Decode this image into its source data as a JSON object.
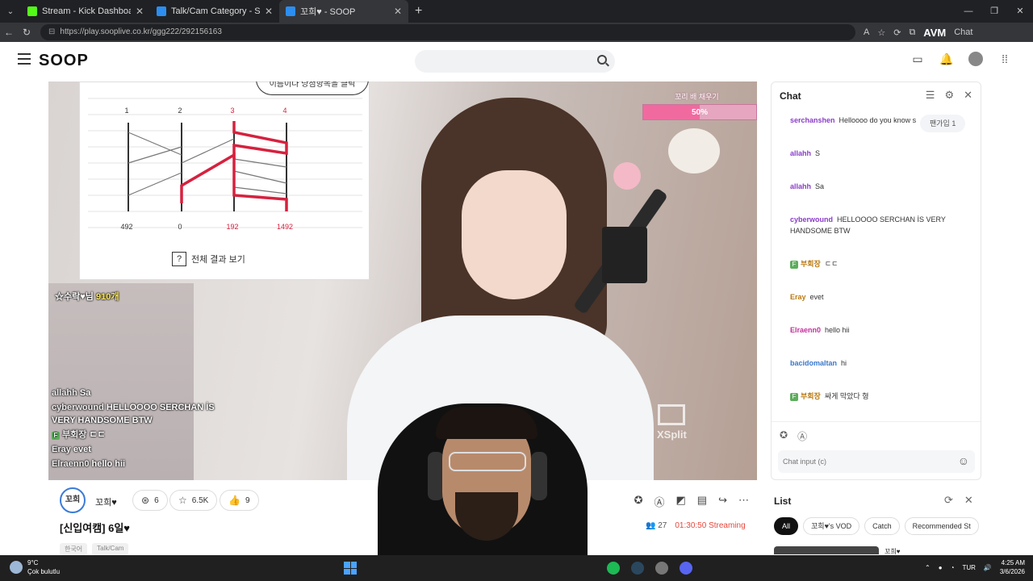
{
  "browser": {
    "tabs": [
      {
        "title": "Stream - Kick Dashboard",
        "favicon_color": "#53fc18"
      },
      {
        "title": "Talk/Cam Category - SOOP",
        "favicon_color": "#2b8ef0"
      },
      {
        "title": "꼬희♥ - SOOP",
        "favicon_color": "#2b8ef0",
        "active": true
      }
    ],
    "url": "https://play.sooplive.co.kr/ggg222/292156163",
    "extension_label": "AVM",
    "chat_link": "Chat"
  },
  "site": {
    "logo": "SOOP",
    "search_placeholder": ""
  },
  "video": {
    "overlay": {
      "top_caption": "이름이나 당첨항목을 클릭",
      "columns": [
        "1",
        "2",
        "3",
        "4"
      ],
      "values": [
        "492",
        "0",
        "192",
        "1492"
      ],
      "caption": "전체 결과 보기"
    },
    "count_label": "☆수락♥님",
    "count_value": "910개",
    "donation_label": "꼬리 배 채우기",
    "donation_percent_label": "50%",
    "donation_fraction": 0.5,
    "watermark": "XSplit",
    "chat": [
      {
        "user": "allahh",
        "text": "Sa"
      },
      {
        "user": "cyberwound",
        "text": "HELLOOOO SERCHAN İS VERY HANDSOME BTW"
      },
      {
        "user": "부회장",
        "text": "ㄷㄷ",
        "badge": "F"
      },
      {
        "user": "Eray",
        "text": "evet"
      },
      {
        "user": "Elraenn0",
        "text": "hello hii"
      }
    ]
  },
  "streamer": {
    "avatar_text": "꼬희",
    "name": "꼬희♥",
    "stats": {
      "badge": "6",
      "favorites": "6.5K",
      "likes": "9"
    },
    "title": "[신입여캠] 6일♥",
    "viewers": "27",
    "duration": "01:30:50 Streaming",
    "tags": [
      "한국어",
      "Talk/Cam"
    ]
  },
  "chat": {
    "title": "Chat",
    "fan_tag": "팬가입 1",
    "messages": [
      {
        "user": "serchanshen",
        "text": "Helloooo do you know s",
        "color": "#8a3cc9"
      },
      {
        "user": "allahh",
        "text": "S",
        "color": "#8a3cc9"
      },
      {
        "user": "allahh",
        "text": "Sa",
        "color": "#8a3cc9"
      },
      {
        "user": "cyberwound",
        "text": "HELLOOOO SERCHAN İS VERY HANDSOME BTW",
        "color": "#8a3cc9"
      },
      {
        "user": "부회장",
        "text": "ㄷㄷ",
        "color": "#b9790f",
        "badge": "F"
      },
      {
        "user": "Eray",
        "text": "evet",
        "color": "#b9790f"
      },
      {
        "user": "Elraenn0",
        "text": "hello hii",
        "color": "#c22f9a"
      },
      {
        "user": "bacidomaltan",
        "text": "hi",
        "color": "#3a78c9"
      },
      {
        "user": "부회장",
        "text": "싸게 막았다 형",
        "color": "#b9790f",
        "badge": "F"
      }
    ],
    "input_placeholder": "Chat input (c)"
  },
  "list": {
    "title": "List",
    "tabs": [
      "All",
      "꼬희♥'s VOD",
      "Catch",
      "Recommended St"
    ],
    "first_item_title": "꼬희♥"
  },
  "taskbar": {
    "temperature": "9°C",
    "weather": "Çok bulutlu",
    "language": "TUR",
    "time": "4:25 AM",
    "date": "3/6/2026"
  }
}
